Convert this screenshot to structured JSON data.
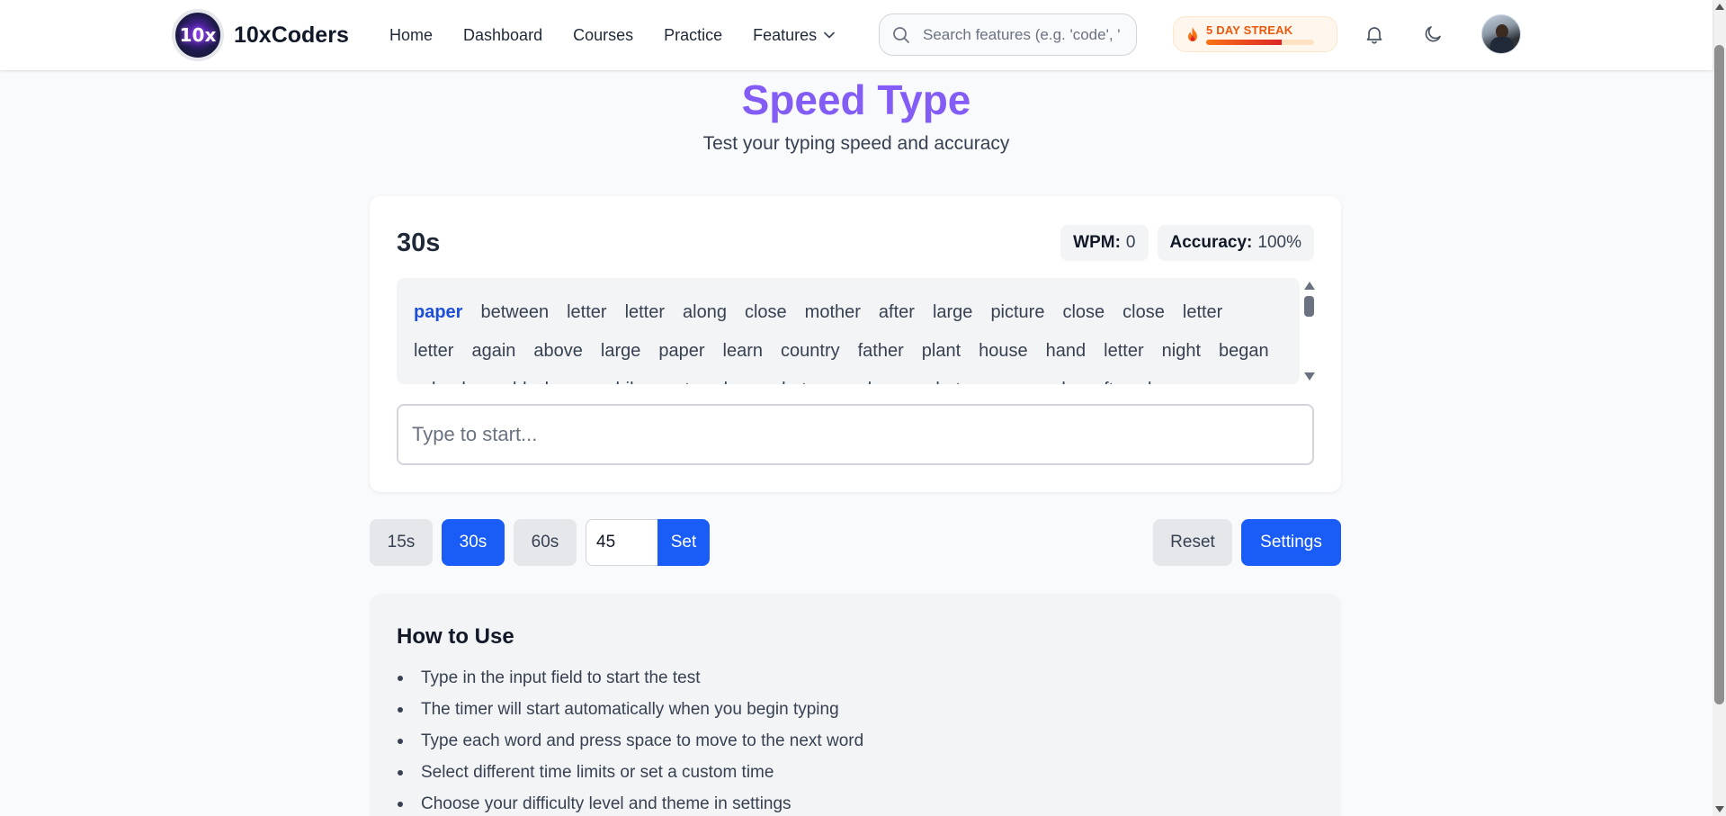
{
  "navbar": {
    "logo_text": "10x",
    "brand": "10xCoders",
    "links": [
      "Home",
      "Dashboard",
      "Courses",
      "Practice"
    ],
    "features_label": "Features",
    "search_placeholder": "Search features (e.g. 'code', 'practice')",
    "streak_label": "5 DAY STREAK",
    "streak_progress": 0.7,
    "icons": [
      "search-icon",
      "fire-icon",
      "bell-icon",
      "moon-icon",
      "chevron-down-icon"
    ]
  },
  "header": {
    "title": "Speed Type",
    "subtitle": "Test your typing speed and accuracy"
  },
  "test": {
    "timer": "30s",
    "wpm_label": "WPM:",
    "wpm_value": "0",
    "accuracy_label": "Accuracy:",
    "accuracy_value": "100%",
    "words": [
      "paper",
      "between",
      "letter",
      "letter",
      "along",
      "close",
      "mother",
      "after",
      "large",
      "picture",
      "close",
      "close",
      "letter",
      "letter",
      "again",
      "above",
      "large",
      "paper",
      "learn",
      "country",
      "father",
      "plant",
      "house",
      "hand",
      "letter",
      "night",
      "began",
      "school",
      "world",
      "large",
      "while",
      "water",
      "large",
      "between",
      "began",
      "between",
      "people",
      "after",
      "large"
    ],
    "current_word_index": 0,
    "input_placeholder": "Type to start..."
  },
  "controls": {
    "time_15": "15s",
    "time_30": "30s",
    "time_60": "60s",
    "custom_value": "45",
    "set_label": "Set",
    "reset_label": "Reset",
    "settings_label": "Settings"
  },
  "howto": {
    "title": "How to Use",
    "items": [
      "Type in the input field to start the test",
      "The timer will start automatically when you begin typing",
      "Type each word and press space to move to the next word",
      "Select different time limits or set a custom time",
      "Choose your difficulty level and theme in settings"
    ]
  },
  "colors": {
    "accent": "#1a5cf6",
    "title_gradient_start": "#7c5cf5",
    "streak": "#ea580c"
  }
}
